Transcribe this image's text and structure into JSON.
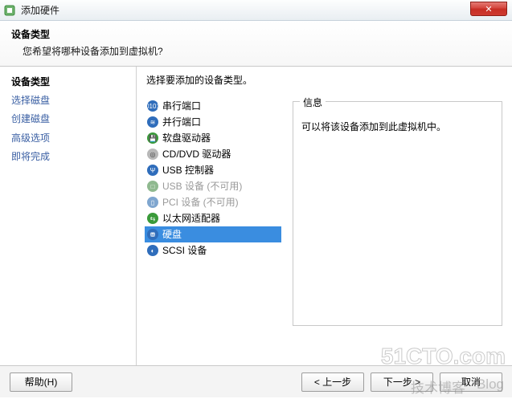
{
  "window": {
    "title": "添加硬件",
    "close_glyph": "✕"
  },
  "header": {
    "title": "设备类型",
    "subtitle": "您希望将哪种设备添加到虚拟机?"
  },
  "sidebar": {
    "steps": [
      {
        "label": "设备类型",
        "current": true
      },
      {
        "label": "选择磁盘",
        "current": false
      },
      {
        "label": "创建磁盘",
        "current": false
      },
      {
        "label": "高级选项",
        "current": false
      },
      {
        "label": "即将完成",
        "current": false
      }
    ]
  },
  "main": {
    "instruction": "选择要添加的设备类型。",
    "devices": [
      {
        "label": "串行端口",
        "icon": "serial-port-icon",
        "disabled": false,
        "selected": false
      },
      {
        "label": "并行端口",
        "icon": "parallel-port-icon",
        "disabled": false,
        "selected": false
      },
      {
        "label": "软盘驱动器",
        "icon": "floppy-drive-icon",
        "disabled": false,
        "selected": false
      },
      {
        "label": "CD/DVD 驱动器",
        "icon": "cd-dvd-drive-icon",
        "disabled": false,
        "selected": false
      },
      {
        "label": "USB 控制器",
        "icon": "usb-controller-icon",
        "disabled": false,
        "selected": false
      },
      {
        "label": "USB 设备 (不可用)",
        "icon": "usb-device-icon",
        "disabled": true,
        "selected": false
      },
      {
        "label": "PCI 设备 (不可用)",
        "icon": "pci-device-icon",
        "disabled": true,
        "selected": false
      },
      {
        "label": "以太网适配器",
        "icon": "ethernet-adapter-icon",
        "disabled": false,
        "selected": false
      },
      {
        "label": "硬盘",
        "icon": "hard-disk-icon",
        "disabled": false,
        "selected": true
      },
      {
        "label": "SCSI 设备",
        "icon": "scsi-device-icon",
        "disabled": false,
        "selected": false
      }
    ],
    "info": {
      "legend": "信息",
      "text": "可以将该设备添加到此虚拟机中。"
    }
  },
  "footer": {
    "help": "帮助(H)",
    "back": "< 上一步",
    "next": "下一步 >",
    "cancel": "取消"
  },
  "watermark": {
    "line1": "51CTO.com",
    "line2a": "技术博客",
    "line2b": "Blog"
  },
  "icons": {
    "serial-port-icon": {
      "bg": "#2f6dbb",
      "glyph": "0101",
      "fg": "#fff"
    },
    "parallel-port-icon": {
      "bg": "#2f6dbb",
      "glyph": "≋",
      "fg": "#fff"
    },
    "floppy-drive-icon": {
      "bg": "#3a9a3a",
      "glyph": "💾",
      "fg": "#fff"
    },
    "cd-dvd-drive-icon": {
      "bg": "#b8b8b8",
      "glyph": "◎",
      "fg": "#444"
    },
    "usb-controller-icon": {
      "bg": "#2f6dbb",
      "glyph": "Ψ",
      "fg": "#fff"
    },
    "usb-device-icon": {
      "bg": "#8fb98f",
      "glyph": "□",
      "fg": "#fff"
    },
    "pci-device-icon": {
      "bg": "#7fa6cf",
      "glyph": "▯",
      "fg": "#fff"
    },
    "ethernet-adapter-icon": {
      "bg": "#3a9a3a",
      "glyph": "⇆",
      "fg": "#fff"
    },
    "hard-disk-icon": {
      "bg": "#2f6dbb",
      "glyph": "⛃",
      "fg": "#fff"
    },
    "scsi-device-icon": {
      "bg": "#2f6dbb",
      "glyph": "◐",
      "fg": "#fff"
    }
  }
}
